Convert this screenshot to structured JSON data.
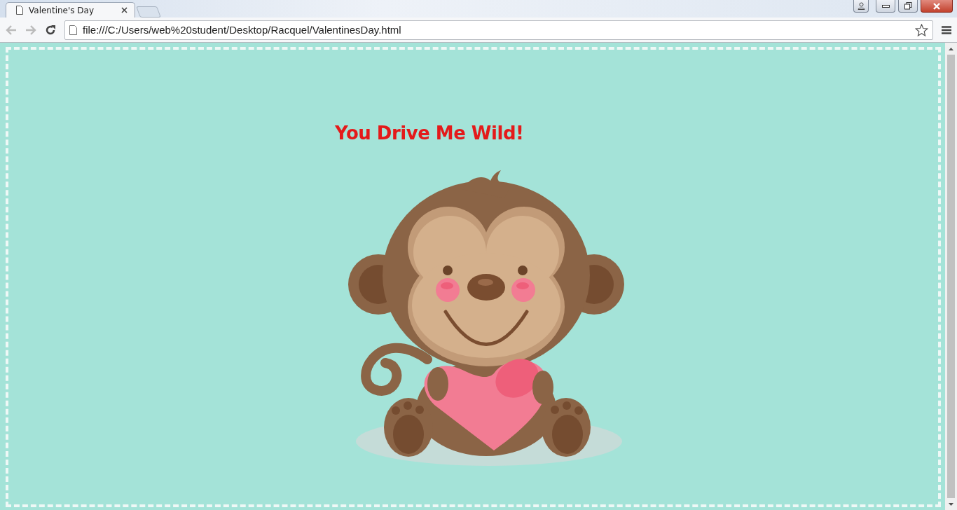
{
  "tabs": [
    {
      "title": "Valentine's Day",
      "selected": true
    }
  ],
  "address_bar": {
    "url": "file:///C:/Users/web%20student/Desktop/Racquel/ValentinesDay.html"
  },
  "page": {
    "heading": "You Drive Me Wild!"
  }
}
